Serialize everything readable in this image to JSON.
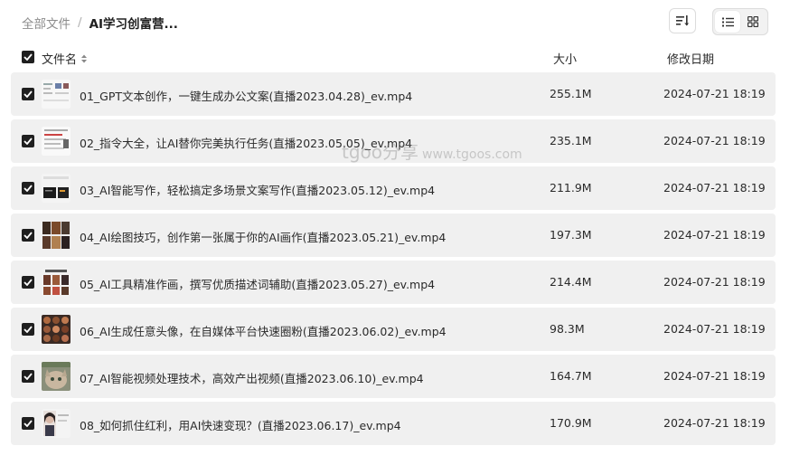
{
  "breadcrumb": {
    "root": "全部文件",
    "separator": "/",
    "current": "AI学习创富营..."
  },
  "columns": {
    "name": "文件名",
    "size": "大小",
    "date": "修改日期"
  },
  "icons": {
    "sort": "sort-lines-icon",
    "list_view": "list-view-icon",
    "grid_view": "grid-view-icon",
    "checkbox": "check-icon",
    "name_sort": "sort-updown-icon"
  },
  "files": [
    {
      "name": "01_GPT文本创作，一键生成办公文案(直播2023.04.28)_ev.mp4",
      "size": "255.1M",
      "date": "2024-07-21 18:19",
      "thumb": "document-thumbnail"
    },
    {
      "name": "02_指令大全，让AI替你完美执行任务(直播2023.05.05)_ev.mp4",
      "size": "235.1M",
      "date": "2024-07-21 18:19",
      "thumb": "document-thumbnail"
    },
    {
      "name": "03_AI智能写作，轻松搞定多场景文案写作(直播2023.05.12)_ev.mp4",
      "size": "211.9M",
      "date": "2024-07-21 18:19",
      "thumb": "screen-thumbnail"
    },
    {
      "name": "04_AI绘图技巧，创作第一张属于你的AI画作(直播2023.05.21)_ev.mp4",
      "size": "197.3M",
      "date": "2024-07-21 18:19",
      "thumb": "image-grid-thumbnail"
    },
    {
      "name": "05_AI工具精准作画，撰写优质描述词辅助(直播2023.05.27)_ev.mp4",
      "size": "214.4M",
      "date": "2024-07-21 18:19",
      "thumb": "image-grid-thumbnail"
    },
    {
      "name": "06_AI生成任意头像，在自媒体平台快速圈粉(直播2023.06.02)_ev.mp4",
      "size": "98.3M",
      "date": "2024-07-21 18:19",
      "thumb": "avatar-grid-thumbnail"
    },
    {
      "name": "07_AI智能视频处理技术，高效产出视频(直播2023.06.10)_ev.mp4",
      "size": "164.7M",
      "date": "2024-07-21 18:19",
      "thumb": "cat-photo-thumbnail"
    },
    {
      "name": "08_如何抓住红利，用AI快速变现？(直播2023.06.17)_ev.mp4",
      "size": "170.9M",
      "date": "2024-07-21 18:19",
      "thumb": "portrait-thumbnail"
    }
  ],
  "watermark": {
    "logo": "tgoo分享",
    "url": "www.tgoos.com"
  },
  "colors": {
    "row_bg": "#f0f0f0",
    "checkbox": "#1f1f1f",
    "muted": "#8c8c8c"
  }
}
